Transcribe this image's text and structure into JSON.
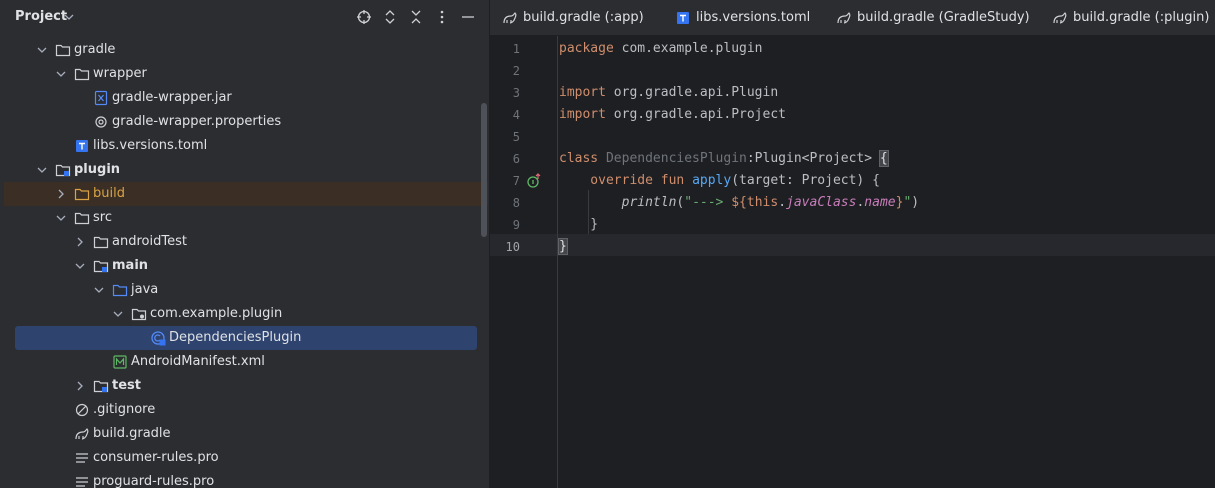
{
  "panel": {
    "title": "Project",
    "icons": [
      "locate-icon",
      "expand-all-icon",
      "collapse-all-icon",
      "more-options-icon",
      "minimize-icon"
    ]
  },
  "tree": [
    {
      "label": "gradle",
      "depth": 1,
      "expanded": true,
      "icon": "folder-icon",
      "bold": false
    },
    {
      "label": "wrapper",
      "depth": 2,
      "expanded": true,
      "icon": "folder-icon",
      "bold": false
    },
    {
      "label": "gradle-wrapper.jar",
      "depth": 3,
      "icon": "jar-file-icon"
    },
    {
      "label": "gradle-wrapper.properties",
      "depth": 3,
      "icon": "properties-file-icon"
    },
    {
      "label": "libs.versions.toml",
      "depth": 2,
      "icon": "toml-file-icon"
    },
    {
      "label": "plugin",
      "depth": 1,
      "expanded": true,
      "icon": "module-folder-icon",
      "bold": true
    },
    {
      "label": "build",
      "depth": 2,
      "expanded": false,
      "icon": "build-folder-icon",
      "highlighted": true
    },
    {
      "label": "src",
      "depth": 2,
      "expanded": true,
      "icon": "folder-icon"
    },
    {
      "label": "androidTest",
      "depth": 3,
      "expanded": false,
      "icon": "folder-icon"
    },
    {
      "label": "main",
      "depth": 3,
      "expanded": true,
      "icon": "source-set-folder-icon",
      "bold": true
    },
    {
      "label": "java",
      "depth": 4,
      "expanded": true,
      "icon": "source-root-folder-icon"
    },
    {
      "label": "com.example.plugin",
      "depth": 5,
      "expanded": true,
      "icon": "package-folder-icon"
    },
    {
      "label": "DependenciesPlugin",
      "depth": 6,
      "icon": "kotlin-class-icon",
      "selected": true
    },
    {
      "label": "AndroidManifest.xml",
      "depth": 4,
      "icon": "manifest-file-icon"
    },
    {
      "label": "test",
      "depth": 3,
      "expanded": false,
      "icon": "source-set-folder-icon",
      "bold": true
    },
    {
      "label": ".gitignore",
      "depth": 2,
      "icon": "gitignore-file-icon"
    },
    {
      "label": "build.gradle",
      "depth": 2,
      "icon": "gradle-file-icon"
    },
    {
      "label": "consumer-rules.pro",
      "depth": 2,
      "icon": "text-file-icon"
    },
    {
      "label": "proguard-rules.pro",
      "depth": 2,
      "icon": "text-file-icon"
    }
  ],
  "tabs": [
    {
      "label": "build.gradle (:app)",
      "icon": "gradle-file-icon"
    },
    {
      "label": "libs.versions.toml",
      "icon": "toml-file-icon"
    },
    {
      "label": "build.gradle (GradleStudy)",
      "icon": "gradle-file-icon"
    },
    {
      "label": "build.gradle (:plugin)",
      "icon": "gradle-file-icon"
    }
  ],
  "editor": {
    "current_line": 10,
    "gutter_marker_line": 7,
    "gutter_marker_icon": "implementing-method-icon",
    "lines": [
      {
        "n": "1",
        "tokens": [
          {
            "t": "package",
            "c": "kw"
          },
          {
            "t": " com.example.plugin",
            "c": "pl"
          }
        ]
      },
      {
        "n": "2",
        "tokens": []
      },
      {
        "n": "3",
        "tokens": [
          {
            "t": "import",
            "c": "kw"
          },
          {
            "t": " org.gradle.api.Plugin",
            "c": "pl"
          }
        ]
      },
      {
        "n": "4",
        "tokens": [
          {
            "t": "import",
            "c": "kw"
          },
          {
            "t": " org.gradle.api.Project",
            "c": "pl"
          }
        ]
      },
      {
        "n": "5",
        "tokens": []
      },
      {
        "n": "6",
        "tokens": [
          {
            "t": "class",
            "c": "kw"
          },
          {
            "t": " ",
            "c": "pl"
          },
          {
            "t": "DependenciesPlugin",
            "c": "cls"
          },
          {
            "t": ":Plugin<Project> ",
            "c": "pl"
          },
          {
            "t": "{",
            "c": "brace-hl"
          }
        ]
      },
      {
        "n": "7",
        "tokens": [
          {
            "t": "    override fun",
            "c": "kw"
          },
          {
            "t": " ",
            "c": "pl"
          },
          {
            "t": "apply",
            "c": "fn"
          },
          {
            "t": "(target: Project) {",
            "c": "pl"
          }
        ]
      },
      {
        "n": "8",
        "tokens": [
          {
            "t": "        ",
            "c": "pl"
          },
          {
            "t": "println",
            "c": "it"
          },
          {
            "t": "(",
            "c": "pl"
          },
          {
            "t": "\"---> ",
            "c": "str"
          },
          {
            "t": "${",
            "c": "kw"
          },
          {
            "t": "this",
            "c": "kw"
          },
          {
            "t": ".",
            "c": "pl"
          },
          {
            "t": "javaClass",
            "c": "prop"
          },
          {
            "t": ".",
            "c": "pl"
          },
          {
            "t": "name",
            "c": "prop"
          },
          {
            "t": "}",
            "c": "kw"
          },
          {
            "t": "\"",
            "c": "str"
          },
          {
            "t": ")",
            "c": "pl"
          }
        ]
      },
      {
        "n": "9",
        "tokens": [
          {
            "t": "    }",
            "c": "pl"
          }
        ]
      },
      {
        "n": "10",
        "tokens": [
          {
            "t": "}",
            "c": "brace-hl"
          }
        ]
      }
    ]
  },
  "colors": {
    "panel_bg": "#2b2d30",
    "editor_bg": "#1e1f22",
    "selection": "#2e436e",
    "keyword": "#cf8e6d",
    "string": "#6aab73",
    "function": "#56a8f5"
  }
}
